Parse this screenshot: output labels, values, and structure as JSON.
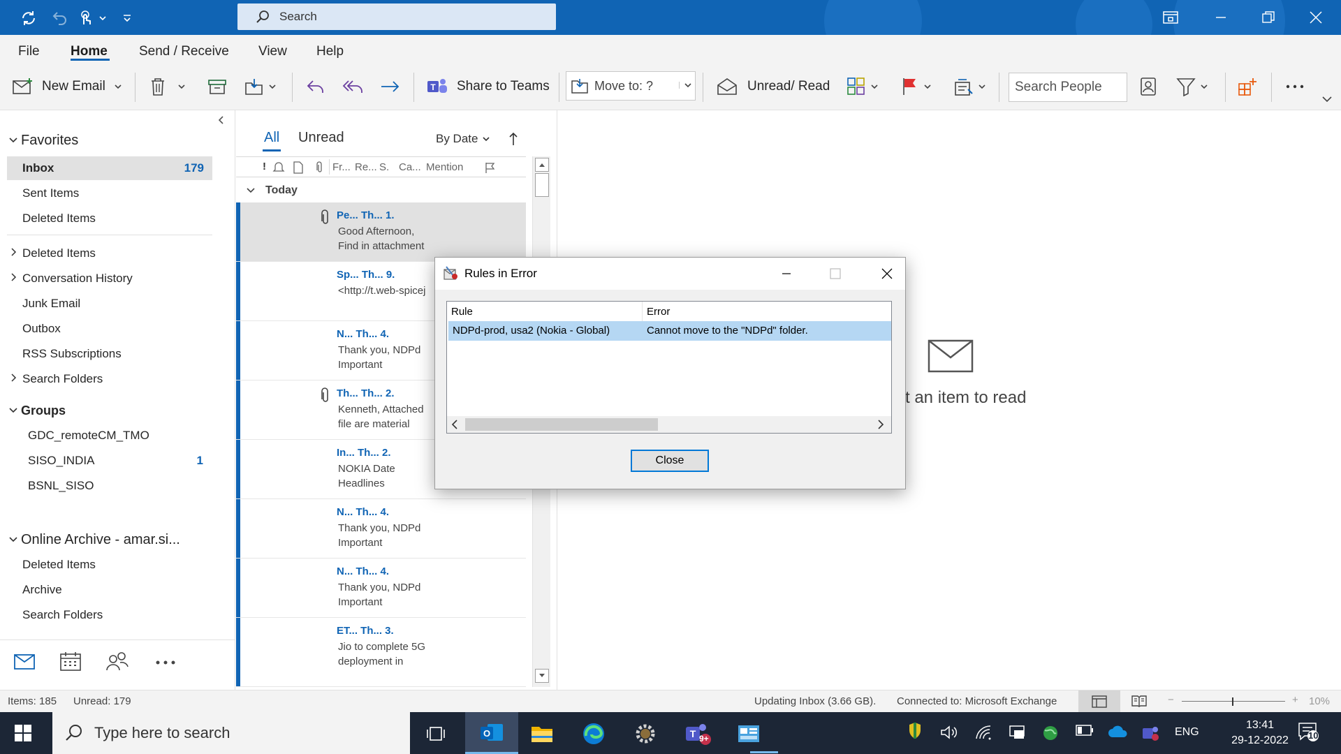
{
  "titlebar": {
    "search_placeholder": "Search",
    "background_color": "#1064b4"
  },
  "menu": {
    "items": [
      "File",
      "Home",
      "Send / Receive",
      "View",
      "Help"
    ],
    "active": "Home"
  },
  "ribbon": {
    "new_email": "New Email",
    "share_to_teams": "Share to Teams",
    "move_to": "Move to: ?",
    "unread_read": "Unread/ Read",
    "search_people_placeholder": "Search People"
  },
  "folders": {
    "favorites_label": "Favorites",
    "favorites": [
      {
        "label": "Inbox",
        "count": "179"
      },
      {
        "label": "Sent Items"
      },
      {
        "label": "Deleted Items"
      }
    ],
    "tree": [
      {
        "label": "Deleted Items"
      },
      {
        "label": "Conversation History"
      },
      {
        "label": "Junk Email"
      },
      {
        "label": "Outbox"
      },
      {
        "label": "RSS Subscriptions"
      },
      {
        "label": "Search Folders"
      }
    ],
    "groups_label": "Groups",
    "groups": [
      {
        "label": "GDC_remoteCM_TMO"
      },
      {
        "label": "SISO_INDIA",
        "count": "1"
      },
      {
        "label": "BSNL_SISO"
      }
    ],
    "archive_label": "Online Archive - amar.si...",
    "archive": [
      {
        "label": "Deleted Items"
      },
      {
        "label": "Archive"
      },
      {
        "label": "Search Folders"
      }
    ]
  },
  "message_list": {
    "tab_all": "All",
    "tab_unread": "Unread",
    "sort": "By Date",
    "columns": [
      "!",
      "Fr...",
      "Re...",
      "S.",
      "Ca...",
      "Mention"
    ],
    "group_header": "Today",
    "messages": [
      {
        "header": "Pe... Th... 1.",
        "line2": "Good Afternoon,",
        "line3": "Find in attachment",
        "attachment": true,
        "selected": true
      },
      {
        "header": "Sp... Th... 9.",
        "line2": "<http://t.web-spicej",
        "line3": "",
        "attachment": false
      },
      {
        "header": "N...  Th... 4.",
        "line2": "Thank you, NDPd",
        "line3": "Important",
        "attachment": false
      },
      {
        "header": "Th... Th... 2.",
        "line2": "Kenneth,  Attached",
        "line3": "file are material",
        "attachment": true
      },
      {
        "header": "In... Th... 2.",
        "line2": "NOKIA  Date",
        "line3": "Headlines",
        "attachment": false
      },
      {
        "header": "N...  Th... 4.",
        "line2": "Thank you, NDPd",
        "line3": "Important",
        "attachment": false
      },
      {
        "header": "N...  Th... 4.",
        "line2": "Thank you, NDPd",
        "line3": "Important",
        "attachment": false
      },
      {
        "header": "ET... Th... 3.",
        "line2": "Jio to complete 5G",
        "line3": "deployment in",
        "attachment": false
      }
    ]
  },
  "reading_pane": {
    "empty_text": "t an item to read"
  },
  "dialog": {
    "title": "Rules in Error",
    "col_rule": "Rule",
    "col_error": "Error",
    "rule": "NDPd-prod, usa2 (Nokia - Global)",
    "error": "Cannot move to the \"NDPd\" folder.",
    "close_button": "Close"
  },
  "statusbar": {
    "items": "Items: 185",
    "unread": "Unread: 179",
    "updating": "Updating Inbox (3.66 GB).",
    "connected": "Connected to: Microsoft Exchange",
    "zoom": "10%"
  },
  "taskbar": {
    "search_placeholder": "Type here to search",
    "teams_badge": "9+",
    "language": "ENG",
    "time": "13:41",
    "date": "29-12-2022",
    "notification_count": "10"
  }
}
